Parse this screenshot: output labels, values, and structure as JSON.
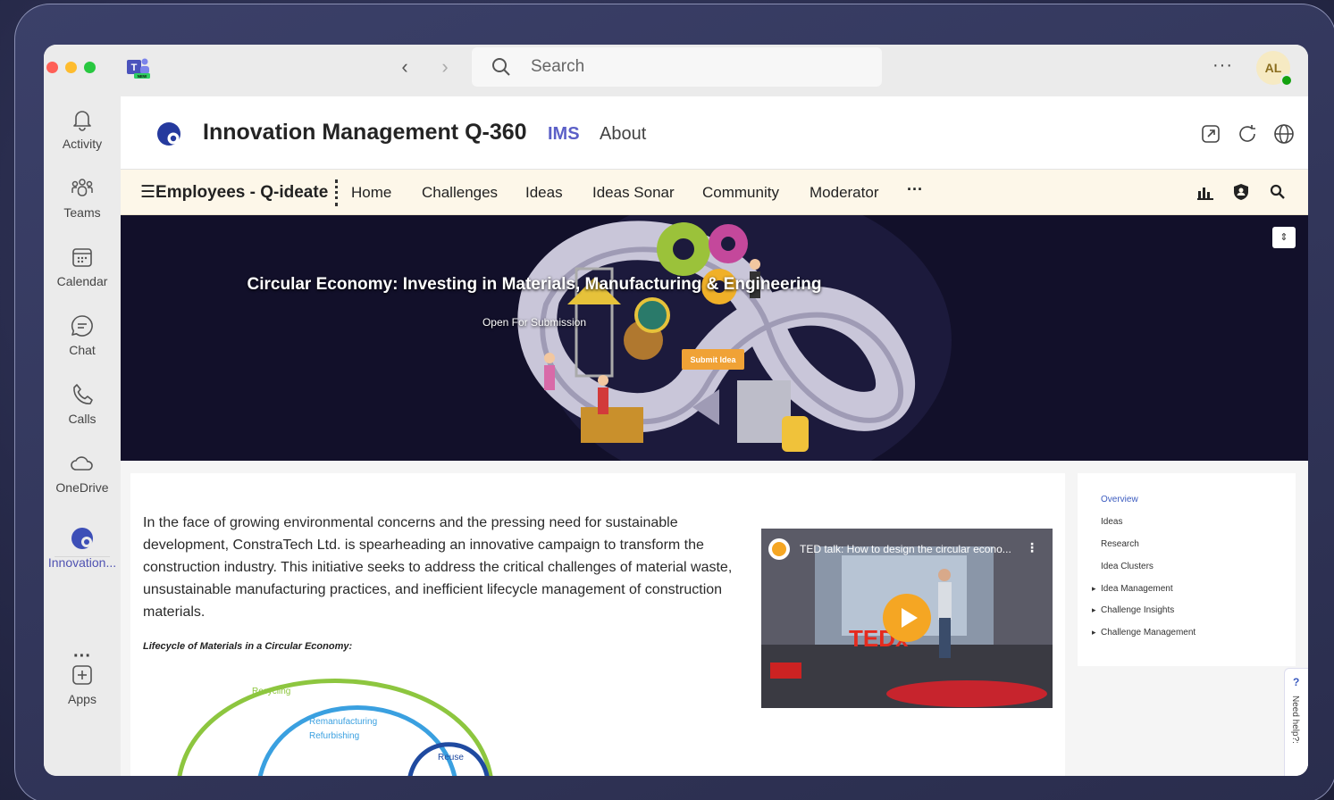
{
  "titlebar": {
    "search_placeholder": "Search",
    "more_label": "···",
    "avatar_initials": "AL"
  },
  "rail": {
    "items": [
      {
        "label": "Activity",
        "icon": "bell-icon"
      },
      {
        "label": "Teams",
        "icon": "teams-icon"
      },
      {
        "label": "Calendar",
        "icon": "calendar-icon"
      },
      {
        "label": "Chat",
        "icon": "chat-icon"
      },
      {
        "label": "Calls",
        "icon": "phone-icon"
      },
      {
        "label": "OneDrive",
        "icon": "cloud-icon"
      },
      {
        "label": "Innovation...",
        "icon": "innovation-app-icon"
      },
      {
        "label": "Apps",
        "icon": "add-apps-icon"
      }
    ],
    "more_label": "···"
  },
  "app": {
    "title": "Innovation Management Q-360",
    "tabs": [
      "IMS",
      "About"
    ],
    "accent_color": "#5b5fc7"
  },
  "subnav": {
    "brand": "☰Employees - Q-ideate",
    "links": [
      "Home",
      "Challenges",
      "Ideas",
      "Ideas Sonar",
      "Community",
      "Moderator"
    ],
    "more_label": "···"
  },
  "banner": {
    "title": "Circular Economy: Investing in Materials, Manufacturing & Engineering",
    "status": "Open For Submission",
    "submit_label": "Submit Idea",
    "button_color": "#f0a236"
  },
  "main": {
    "intro": "In the face of growing environmental concerns and the pressing need for sustainable development, ConstraTech Ltd. is spearheading an innovative campaign to transform the construction industry. This initiative seeks to address the critical challenges of material waste, unsustainable manufacturing practices, and inefficient lifecycle management of construction materials.",
    "lifecycle_title": "Lifecycle of Materials in a Circular Economy:",
    "diagram_labels": {
      "recycling": "Recycling",
      "remanufacturing": "Remanufacturing",
      "refurbishing": "Refurbishing",
      "reuse": "Reuse"
    },
    "video": {
      "title": "TED talk: How to design the circular econo...",
      "menu": "⋮"
    }
  },
  "side_nav": {
    "links": [
      "Overview",
      "Ideas",
      "Research",
      "Idea Clusters"
    ],
    "tree_links": [
      "Idea Management",
      "Challenge Insights",
      "Challenge Management"
    ]
  },
  "help": {
    "icon": "?",
    "label": "Need help?:"
  }
}
